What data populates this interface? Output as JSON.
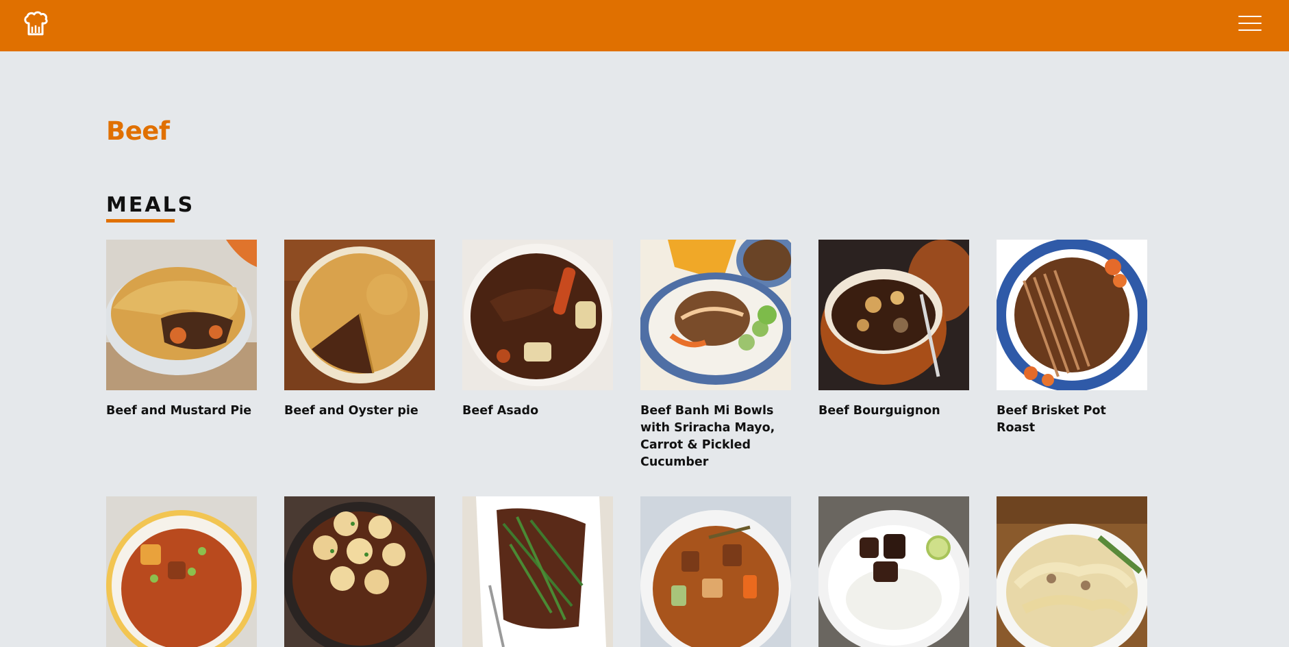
{
  "header": {
    "logo_icon": "chef-hat-icon",
    "menu_icon": "hamburger-menu-icon",
    "background": "#e07000"
  },
  "category": {
    "title": "Beef"
  },
  "meals_section": {
    "title": "MEALS",
    "meals": [
      {
        "name": "Beef and Mustard Pie"
      },
      {
        "name": "Beef and Oyster pie"
      },
      {
        "name": "Beef Asado"
      },
      {
        "name": "Beef Banh Mi Bowls with Sriracha Mayo, Carrot & Pickled Cucumber"
      },
      {
        "name": "Beef Bourguignon"
      },
      {
        "name": "Beef Brisket Pot Roast"
      },
      {
        "name": ""
      },
      {
        "name": ""
      },
      {
        "name": ""
      },
      {
        "name": ""
      },
      {
        "name": ""
      },
      {
        "name": ""
      }
    ]
  },
  "colors": {
    "accent": "#e07000",
    "page_background": "#e5e8eb",
    "text": "#111111"
  }
}
